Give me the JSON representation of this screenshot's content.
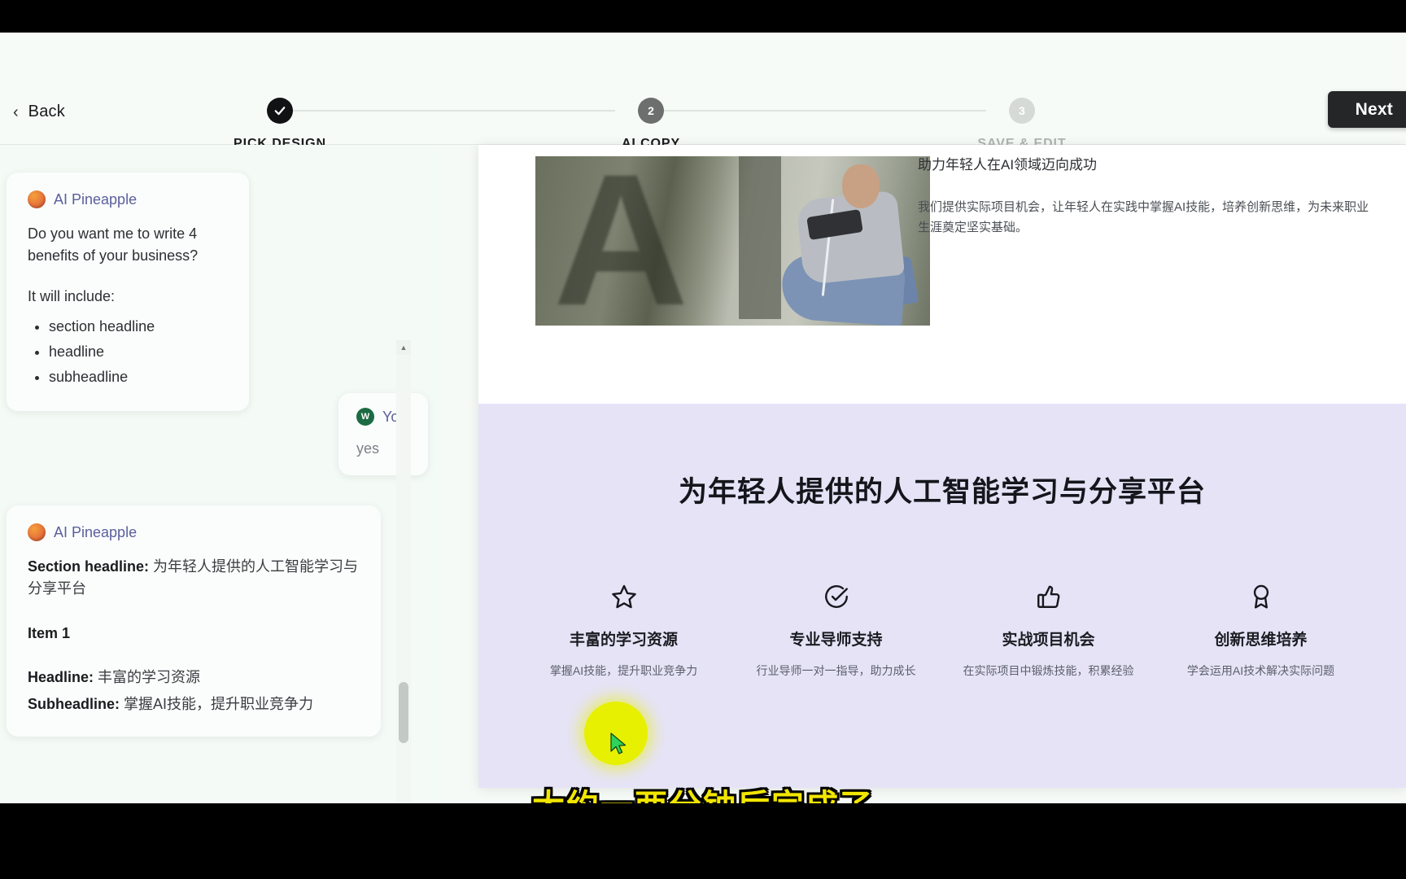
{
  "header": {
    "back_label": "Back",
    "next_label": "Next",
    "steps": [
      {
        "num": "✓",
        "label": "PICK DESIGN",
        "state": "done"
      },
      {
        "num": "2",
        "label": "AI COPY",
        "state": "active"
      },
      {
        "num": "3",
        "label": "SAVE & EDIT",
        "state": "todo"
      }
    ]
  },
  "chat": {
    "ai_name": "AI Pineapple",
    "you_name": "You",
    "you_avatar_initial": "W",
    "message1": {
      "question": "Do you want me to write 4 benefits of your business?",
      "intro": "It will include:",
      "items": [
        "section headline",
        "headline",
        "subheadline"
      ]
    },
    "user_reply": "yes",
    "message2": {
      "section_headline_label": "Section headline:",
      "section_headline_value": "为年轻人提供的人工智能学习与分享平台",
      "item_label": "Item 1",
      "headline_label": "Headline:",
      "headline_value": "丰富的学习资源",
      "subheadline_label": "Subheadline:",
      "subheadline_value": "掌握AI技能，提升职业竞争力"
    }
  },
  "preview": {
    "top_headline": "助力年轻人在AI领域迈向成功",
    "top_paragraph": "我们提供实际项目机会，让年轻人在实践中掌握AI技能，培养创新思维，为未来职业生涯奠定坚实基础。",
    "section_headline": "为年轻人提供的人工智能学习与分享平台",
    "features": [
      {
        "icon": "star-icon",
        "headline": "丰富的学习资源",
        "sub": "掌握AI技能，提升职业竞争力"
      },
      {
        "icon": "check-circle-icon",
        "headline": "专业导师支持",
        "sub": "行业导师一对一指导，助力成长"
      },
      {
        "icon": "thumbs-up-icon",
        "headline": "实战项目机会",
        "sub": "在实际项目中锻炼技能，积累经验"
      },
      {
        "icon": "award-icon",
        "headline": "创新思维培养",
        "sub": "学会运用AI技术解决实际问题"
      }
    ]
  },
  "caption": "大约一两分钟后完成了",
  "colors": {
    "accent_purple_bg": "#e6e3f7",
    "caption_yellow": "#f2e600",
    "cursor_highlight": "#e6f000",
    "dark_button": "#242628"
  }
}
